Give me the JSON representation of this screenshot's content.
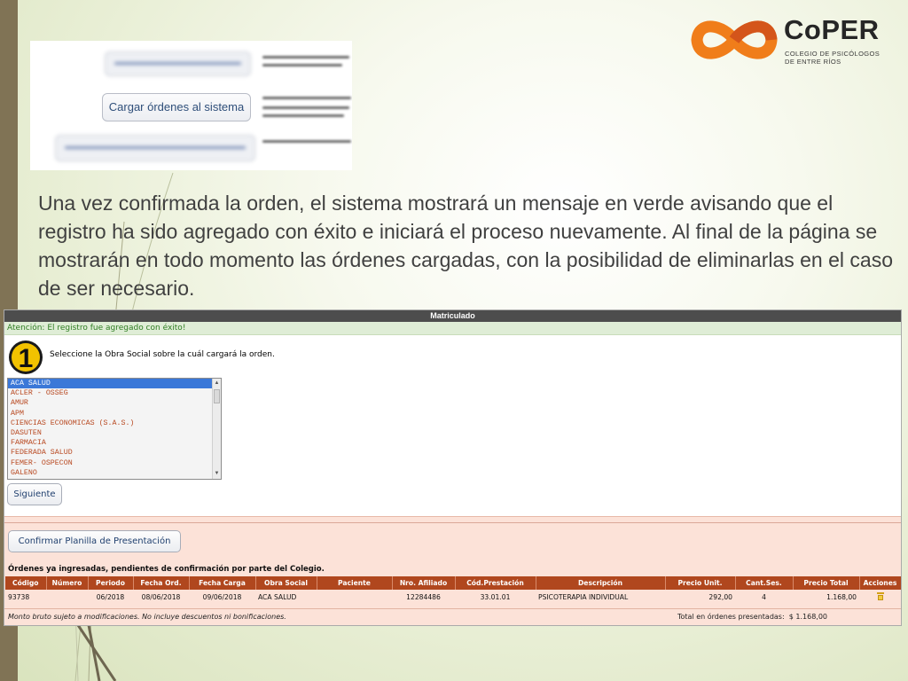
{
  "logo": {
    "name": "CoPER",
    "subtitle_line1": "COLEGIO DE PSICÓLOGOS",
    "subtitle_line2": "DE ENTRE RÍOS",
    "colors": {
      "orange": "#f07d1a",
      "dark_orange": "#d4551a"
    }
  },
  "thumbnail": {
    "button_label": "Cargar órdenes al sistema"
  },
  "paragraph": "Una vez confirmada la orden, el sistema mostrará un mensaje en verde avisando que el registro ha sido agregado con éxito e iniciará el proceso nuevamente. Al final de la página se mostrarán en todo momento las órdenes cargadas, con la posibilidad de eliminarlas en el caso de ser necesario.",
  "app": {
    "title": "Matriculado",
    "alert": "Atención: El registro fue agregado con éxito!",
    "step_number": "1",
    "step_text": "Seleccione la Obra Social sobre la cuál cargará la orden.",
    "obras_sociales": [
      "ACA SALUD",
      "ACLER - OSSEG",
      "AMUR",
      "APM",
      "CIENCIAS ECONOMICAS (S.A.S.)",
      "DASUTEN",
      "FARMACIA",
      "FEDERADA SALUD",
      "FEMER- OSPECON",
      "GALENO"
    ],
    "selected_obra_social": "ACA SALUD",
    "next_button": "Siguiente",
    "confirm_button": "Confirmar Planilla de Presentación",
    "orders_title": "Órdenes ya ingresadas, pendientes de confirmación por parte del Colegio.",
    "table": {
      "headers": [
        "Código",
        "Número",
        "Periodo",
        "Fecha Ord.",
        "Fecha Carga",
        "Obra Social",
        "Paciente",
        "Nro. Afiliado",
        "Cód.Prestación",
        "Descripción",
        "Precio Unit.",
        "Cant.Ses.",
        "Precio Total",
        "Acciones"
      ],
      "rows": [
        {
          "codigo": "93738",
          "numero": "",
          "periodo": "06/2018",
          "fecha_ord": "08/06/2018",
          "fecha_carga": "09/06/2018",
          "obra_social": "ACA SALUD",
          "paciente": "",
          "nro_afiliado": "12284486",
          "cod_prestacion": "33.01.01",
          "descripcion": "PSICOTERAPIA INDIVIDUAL",
          "precio_unit": "292,00",
          "cant_ses": "4",
          "precio_total": "1.168,00",
          "accion_icon": "trash-icon"
        }
      ]
    },
    "footnote": "Monto bruto sujeto a modificaciones. No incluye descuentos ni bonificaciones.",
    "total_label": "Total en órdenes presentadas:",
    "total_value": "$ 1.168,00",
    "colors": {
      "header_bar": "#4d4d4d",
      "alert_bg": "#dfedd6",
      "alert_text": "#2e7d22",
      "table_header": "#b0471e",
      "panel_bg": "#fce2d8"
    }
  }
}
